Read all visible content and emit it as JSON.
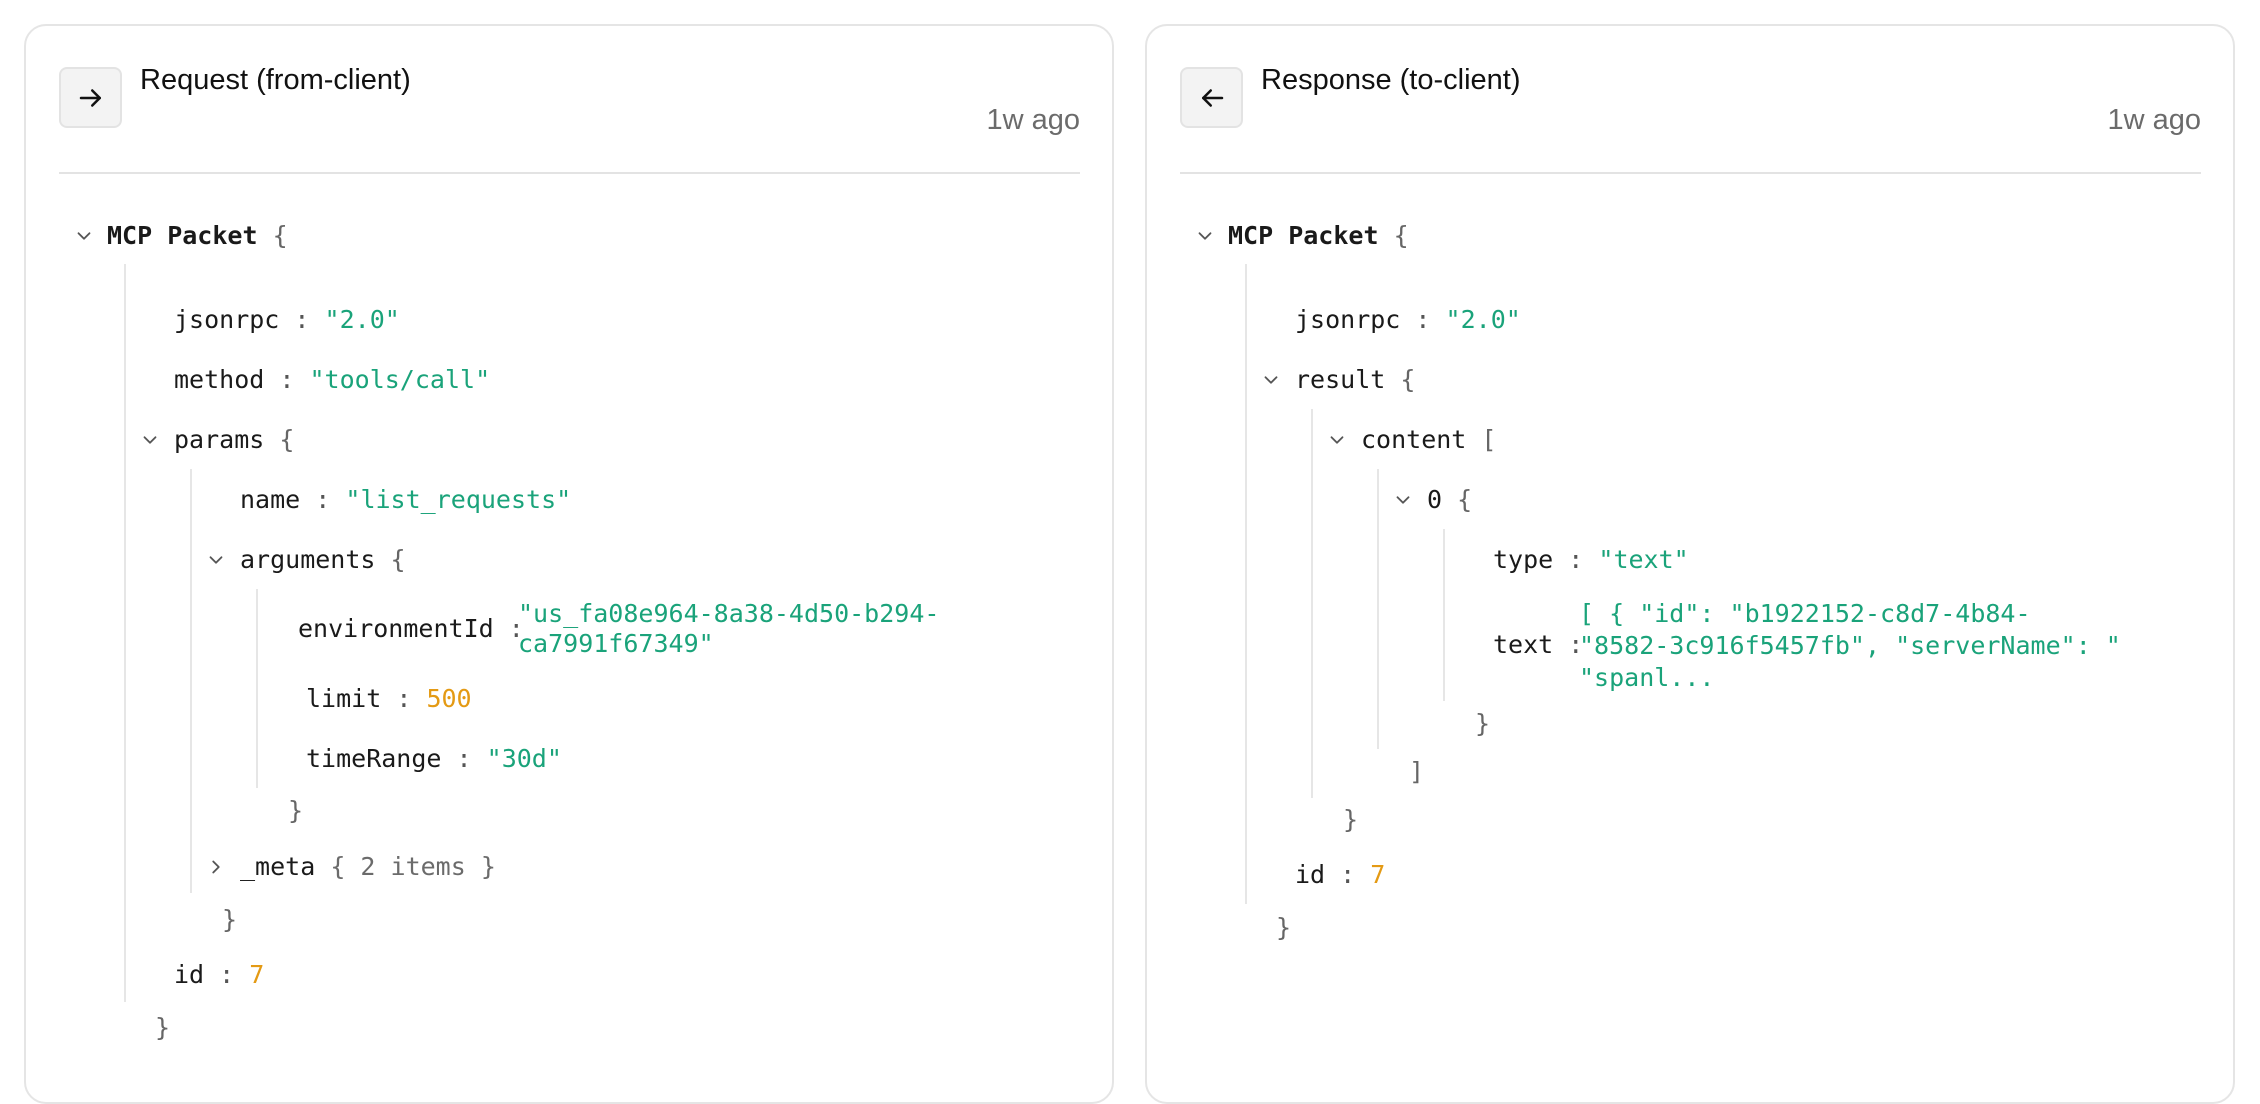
{
  "request": {
    "title": "Request (from-client)",
    "time": "1w ago",
    "icon": "arrow-right-icon",
    "root_label": "MCP Packet",
    "jsonrpc": {
      "key": "jsonrpc",
      "value": "\"2.0\""
    },
    "method": {
      "key": "method",
      "value": "\"tools/call\""
    },
    "params": {
      "key": "params",
      "name": {
        "key": "name",
        "value": "\"list_requests\""
      },
      "arguments": {
        "key": "arguments",
        "environmentId": {
          "key": "environmentId",
          "value_line1": "\"us_fa08e964-8a38-4d50-b294-",
          "value_line2": "ca7991f67349\""
        },
        "limit": {
          "key": "limit",
          "value": "500"
        },
        "timeRange": {
          "key": "timeRange",
          "value": "\"30d\""
        }
      },
      "meta": {
        "key": "_meta",
        "summary": "{ 2 items }"
      }
    },
    "id": {
      "key": "id",
      "value": "7"
    }
  },
  "response": {
    "title": "Response (to-client)",
    "time": "1w ago",
    "icon": "arrow-left-icon",
    "root_label": "MCP Packet",
    "jsonrpc": {
      "key": "jsonrpc",
      "value": "\"2.0\""
    },
    "result": {
      "key": "result",
      "content": {
        "key": "content",
        "item0": {
          "key": "0",
          "type": {
            "key": "type",
            "value": "\"text\""
          },
          "text": {
            "key": "text",
            "value": "[ { \"id\": \"b1922152-c8d7-4b84-\n\"8582-3c916f5457fb\", \"serverName\": \"\n\"spanl..."
          }
        }
      }
    },
    "id": {
      "key": "id",
      "value": "7"
    }
  },
  "syntax": {
    "open_brace": "{",
    "close_brace": "}",
    "open_bracket": "[",
    "close_bracket": "]",
    "colon": ":"
  },
  "colors": {
    "string": "#1aa37a",
    "number": "#e49a14",
    "border": "#e5e5e5",
    "button_bg": "#f3f3f3"
  }
}
